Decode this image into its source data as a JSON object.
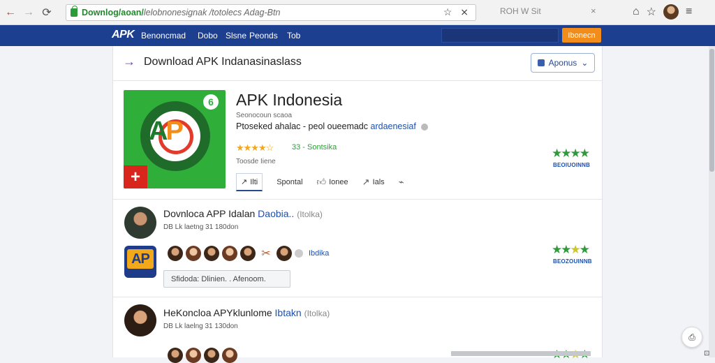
{
  "browser": {
    "url_host": "Downlog/aoan/",
    "url_path": "lelobnonesignak /totolecs Adag-Btn",
    "url_actions": "☆ ⨯",
    "tab_title": "ROH W Sit",
    "tab_close": "×"
  },
  "site": {
    "logo": "APK",
    "nav": [
      "Benoncmad",
      "Dobo",
      "Slsne",
      "Peonds",
      "Tob"
    ],
    "orange_button": "Ibonecn"
  },
  "download_bar": {
    "title": "Download APK Indanasinaslass",
    "button": "Aponus"
  },
  "app": {
    "name": "APK Indonesia",
    "subtitle": "Seonocoun scaoa",
    "desc_main": "Ptoseked ahalac - peol oueemadc",
    "desc_link": "ardaenesiaf",
    "rating_stars": "★★★★☆",
    "rating_text": "33 - Sontsika",
    "meta": "Toosde Iiene",
    "icon_text": "AP",
    "icon_badge": "6",
    "actions": {
      "primary": "Ilti",
      "share": "Spontal",
      "like": "Ionee",
      "forward": "Ials"
    },
    "side_stars": "★★★★",
    "side_caption": "BEOIUOINNB"
  },
  "rows": [
    {
      "title_main": "Dovnloca APP Idalan",
      "title_link": "Daobia..",
      "title_tag": "(Itolka)",
      "meta": "DB Lk laetng 31 180don",
      "app_icon_text": "AP",
      "faces_label": "Ibdika",
      "tag_text": "Sfidoda:   Dlinien.  . Afenoom.",
      "side_stars": "★★★★",
      "side_caption": "BEOZOUINNB"
    },
    {
      "title_main": "HeKoncloa APYklunlome",
      "title_link": "Ibtakn",
      "title_tag": "(Itolka)",
      "meta": "DB Lk laelng 31 130don",
      "side_stars": "★★★★"
    }
  ]
}
